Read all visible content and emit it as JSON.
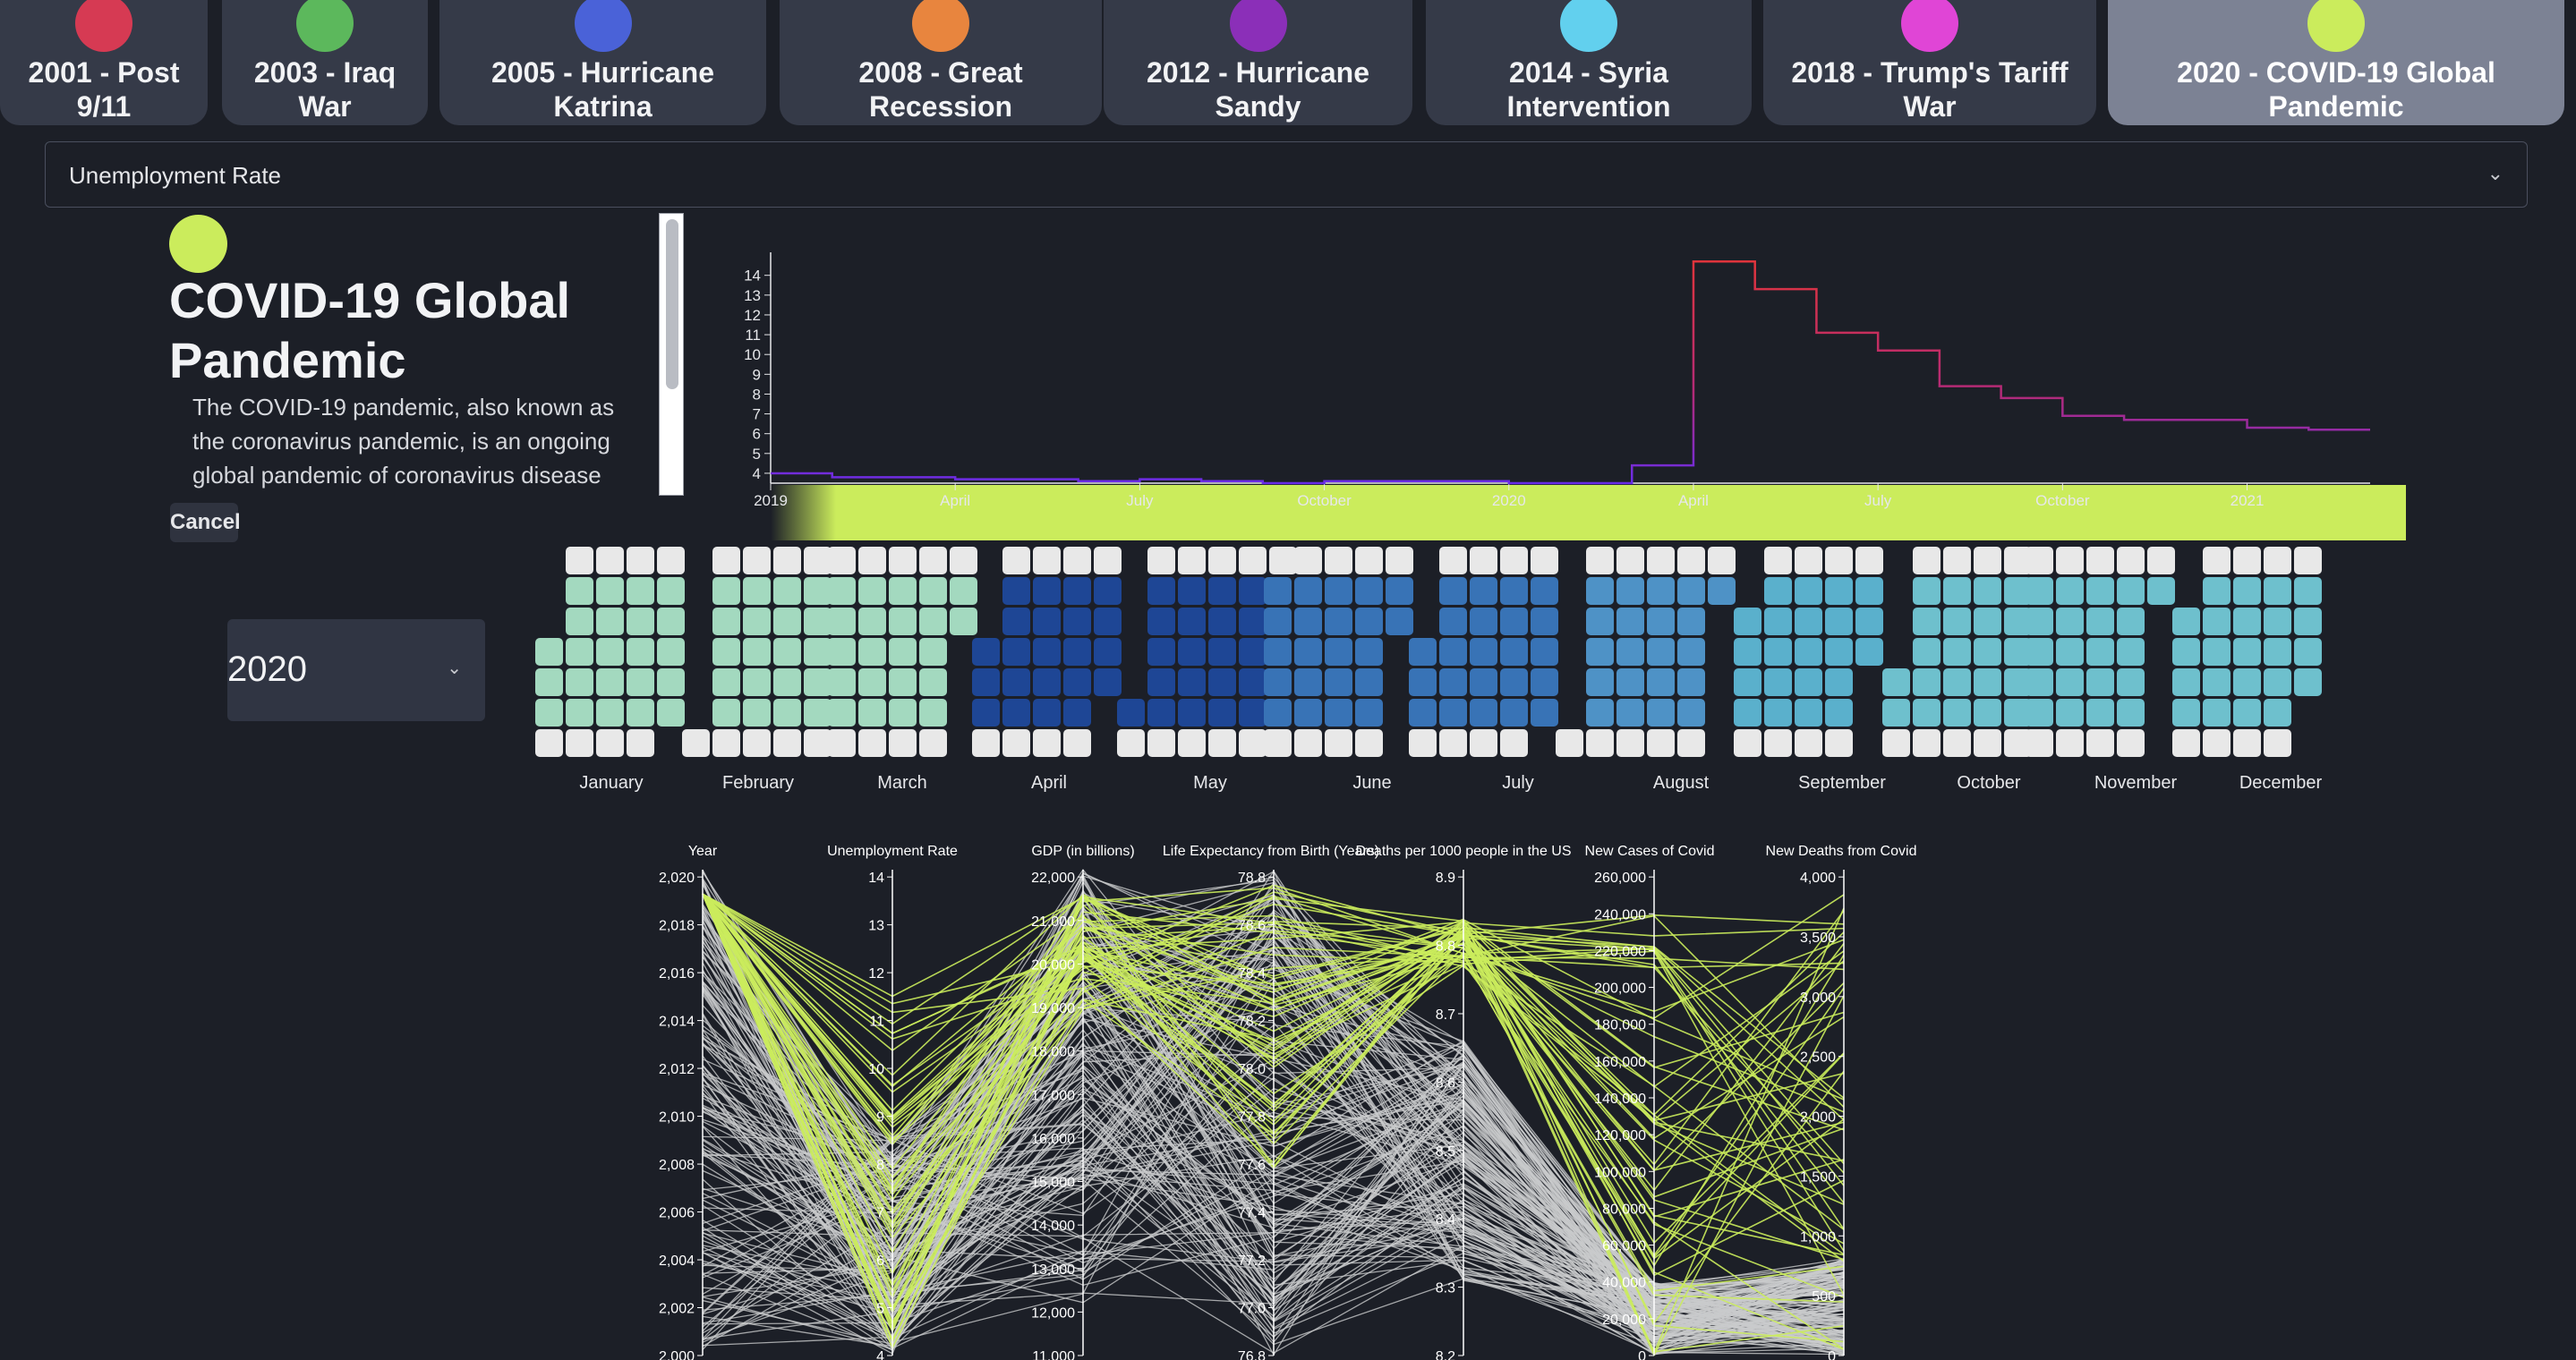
{
  "colors": {
    "background": "#1c1f27",
    "highlight": "#cbec5c",
    "line_before": "#6a2ce8",
    "line_after": "#e0343c"
  },
  "tabs": [
    {
      "label": "2001 - Post 9/11",
      "color": "#d63a53",
      "active": false
    },
    {
      "label": "2003 - Iraq War",
      "color": "#5cb85c",
      "active": false
    },
    {
      "label": "2005 - Hurricane Katrina",
      "color": "#4a62d8",
      "active": false
    },
    {
      "label": "2008 - Great Recession",
      "color": "#e8853e",
      "active": false
    },
    {
      "label": "2012 - Hurricane Sandy",
      "color": "#8b2fb8",
      "active": false
    },
    {
      "label": "2014 - Syria Intervention",
      "color": "#62d0ee",
      "active": false
    },
    {
      "label": "2018 - Trump's Tariff War",
      "color": "#e045d6",
      "active": false
    },
    {
      "label": "2020 - COVID-19 Global Pandemic",
      "color": "#cbec5c",
      "active": true
    }
  ],
  "metric_dropdown": {
    "value": "Unemployment Rate"
  },
  "event": {
    "title": "COVID-19 Global Pandemic",
    "description": "The COVID-19 pandemic, also known as the coronavirus pandemic, is an ongoing global pandemic of coronavirus disease",
    "cancel_label": "Cancel"
  },
  "year_select": {
    "value": "2020"
  },
  "chart_data": [
    {
      "type": "line",
      "title": "",
      "series_name": "Unemployment Rate",
      "y_ticks": [
        4,
        5,
        6,
        7,
        8,
        9,
        10,
        11,
        12,
        13,
        14
      ],
      "ylim": [
        3.5,
        14.8
      ],
      "x_ticks": [
        {
          "label": "2019",
          "month": 0
        },
        {
          "label": "April",
          "month": 3
        },
        {
          "label": "July",
          "month": 6
        },
        {
          "label": "October",
          "month": 9
        },
        {
          "label": "2020",
          "month": 12
        },
        {
          "label": "April",
          "month": 15
        },
        {
          "label": "July",
          "month": 18
        },
        {
          "label": "October",
          "month": 21
        },
        {
          "label": "2021",
          "month": 24
        }
      ],
      "values": [
        4.0,
        3.8,
        3.8,
        3.7,
        3.7,
        3.6,
        3.7,
        3.6,
        3.5,
        3.6,
        3.6,
        3.6,
        3.5,
        3.5,
        4.4,
        14.7,
        13.3,
        11.1,
        10.2,
        8.4,
        7.8,
        6.9,
        6.7,
        6.7,
        6.3,
        6.2
      ],
      "event_start_month": 14
    },
    {
      "type": "heatmap",
      "title": "",
      "year": 2020,
      "months": [
        "January",
        "February",
        "March",
        "April",
        "May",
        "June",
        "July",
        "August",
        "September",
        "October",
        "November",
        "December"
      ],
      "month_colors": [
        "#a3d9bf",
        "#a3d9bf",
        "#a3d9bf",
        "#1e4695",
        "#1e4695",
        "#3873b6",
        "#3873b6",
        "#4e92c6",
        "#5ab0cc",
        "#6ec0cd",
        "#6ec0cd",
        "#6ec0cd"
      ],
      "weekend_color": "#e8e8e8"
    },
    {
      "type": "parallel",
      "title": "",
      "axes": [
        {
          "label": "Year",
          "ticks": [
            "2,000",
            "2,002",
            "2,004",
            "2,006",
            "2,008",
            "2,010",
            "2,012",
            "2,014",
            "2,016",
            "2,018",
            "2,020"
          ]
        },
        {
          "label": "Unemployment Rate",
          "ticks": [
            "4",
            "5",
            "6",
            "7",
            "8",
            "9",
            "10",
            "11",
            "12",
            "13",
            "14"
          ]
        },
        {
          "label": "GDP (in billions)",
          "ticks": [
            "11,000",
            "12,000",
            "13,000",
            "14,000",
            "15,000",
            "16,000",
            "17,000",
            "18,000",
            "19,000",
            "20,000",
            "21,000",
            "22,000"
          ]
        },
        {
          "label": "Life Expectancy from Birth (Years)",
          "ticks": [
            "76.8",
            "77.0",
            "77.2",
            "77.4",
            "77.6",
            "77.8",
            "78.0",
            "78.2",
            "78.4",
            "78.6",
            "78.8"
          ]
        },
        {
          "label": "Deaths per 1000 people in the US",
          "ticks": [
            "8.2",
            "8.3",
            "8.4",
            "8.5",
            "8.6",
            "8.7",
            "8.8",
            "8.9"
          ]
        },
        {
          "label": "New Cases of Covid",
          "ticks": [
            "0",
            "20,000",
            "40,000",
            "60,000",
            "80,000",
            "100,000",
            "120,000",
            "140,000",
            "160,000",
            "180,000",
            "200,000",
            "220,000",
            "240,000",
            "260,000"
          ]
        },
        {
          "label": "New Deaths from Covid",
          "ticks": [
            "0",
            "500",
            "1,000",
            "1,500",
            "2,000",
            "2,500",
            "3,000",
            "3,500",
            "4,000"
          ]
        }
      ]
    }
  ]
}
